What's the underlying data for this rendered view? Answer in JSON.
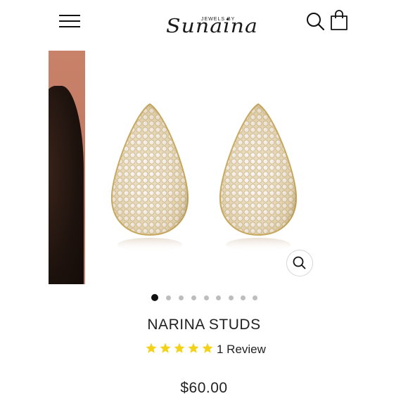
{
  "header": {
    "logo_small": "JEWELS BY",
    "logo_script": "Sunaina",
    "menu_icon": "hamburger-menu-icon",
    "search_icon": "search-icon",
    "cart_icon": "shopping-bag-icon"
  },
  "gallery": {
    "slide_count": 9,
    "active_slide": 1,
    "zoom_icon": "zoom-in-icon",
    "colors": {
      "gold": "#d9c48a",
      "crystal": "#f2ecea"
    }
  },
  "product": {
    "title": "NARINA STUDS",
    "rating_stars": 5,
    "review_text": "1 Review",
    "star_color": "#f4d21a",
    "price": "$60.00"
  }
}
